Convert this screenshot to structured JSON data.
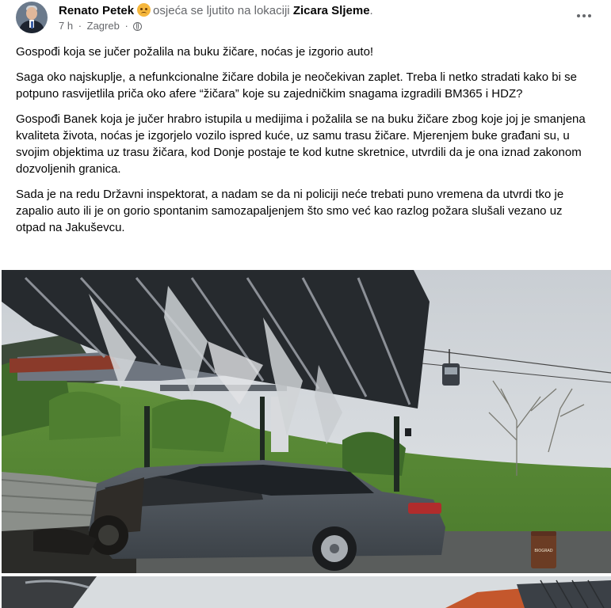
{
  "post": {
    "author": "Renato Petek",
    "feeling_text": "osjeća se ljutito na lokaciji",
    "location": "Zicara Sljeme",
    "location_suffix": ".",
    "time": "7 h",
    "place": "Zagreb",
    "feeling_icon": "angry-emoji-icon",
    "privacy_icon": "globe-icon",
    "paragraphs": [
      "Gospođi koja se jučer požalila na buku žičare, noćas je izgorio auto!",
      "Saga oko najskuplje, a nefunkcionalne žičare dobila je neočekivan zaplet. Treba li netko stradati kako bi se potpuno rasvijetlila priča oko afere “žičara” koje su zajedničkim snagama izgradili BM365 i HDZ?",
      "Gospođi Banek koja je jučer hrabro istupila u medijima i požalila se na buku žičare zbog koje joj je smanjena kvaliteta života, noćas je izgorjelo vozilo ispred kuće, uz samu trasu žičare. Mjerenjem buke građani su, u svojim objektima uz trasu žičara, kod Donje postaje te kod kutne skretnice, utvrdili da je ona iznad zakonom dozvoljenih granica.",
      "Sada je na redu Državni inspektorat, a nadam se da ni policiji neće trebati puno vremena da utvrdi tko je zapalio auto ili je on gorio spontanim samozapaljenjem što smo već kao razlog požara slušali vezano uz otpad na Jakuševcu."
    ],
    "photo_badge": "BIOGRAD"
  },
  "colors": {
    "text_primary": "#050505",
    "text_secondary": "#65676b"
  }
}
